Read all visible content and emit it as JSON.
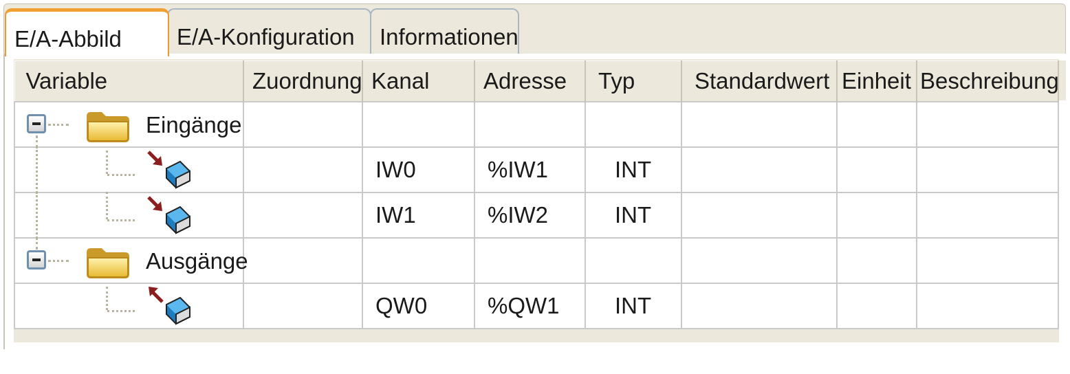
{
  "tabs": [
    {
      "label": "E/A-Abbild",
      "active": true
    },
    {
      "label": "E/A-Konfiguration",
      "active": false
    },
    {
      "label": "Informationen",
      "active": false
    }
  ],
  "columns": [
    "Variable",
    "Zuordnung",
    "Kanal",
    "Adresse",
    "Typ",
    "Standardwert",
    "Einheit",
    "Beschreibung"
  ],
  "rows": [
    {
      "kind": "folder",
      "label": "Eingänge",
      "icon": "folder-icon",
      "expander": "collapse-icon",
      "kanal": "",
      "adresse": "",
      "typ": ""
    },
    {
      "kind": "input",
      "icon": "input-channel-icon",
      "kanal": "IW0",
      "adresse": "%IW1",
      "typ": "INT"
    },
    {
      "kind": "input",
      "icon": "input-channel-icon",
      "kanal": "IW1",
      "adresse": "%IW2",
      "typ": "INT"
    },
    {
      "kind": "folder",
      "label": "Ausgänge",
      "icon": "folder-icon",
      "expander": "collapse-icon",
      "kanal": "",
      "adresse": "",
      "typ": ""
    },
    {
      "kind": "output",
      "icon": "output-channel-icon",
      "kanal": "QW0",
      "adresse": "%QW1",
      "typ": "INT"
    }
  ],
  "colors": {
    "active_tab_accent": "#f0a030",
    "tab_border": "#a9b6c4",
    "panel_background": "#ece8dc",
    "grid_line": "#c9c9c9",
    "folder": "#f5c842",
    "channel_cube": "#2f9be0",
    "arrow": "#8b1e1e"
  }
}
